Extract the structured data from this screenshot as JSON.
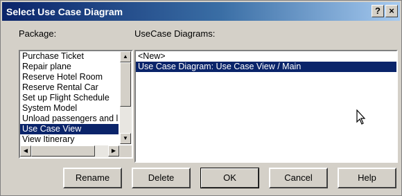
{
  "window": {
    "title": "Select Use Case Diagram",
    "help_glyph": "?",
    "close_glyph": "×"
  },
  "package": {
    "label": "Package:",
    "items": [
      {
        "label": "Purchase Ticket",
        "selected": false
      },
      {
        "label": "Repair plane",
        "selected": false
      },
      {
        "label": "Reserve Hotel Room",
        "selected": false
      },
      {
        "label": "Reserve Rental Car",
        "selected": false
      },
      {
        "label": "Set up Flight Schedule",
        "selected": false
      },
      {
        "label": "System Model",
        "selected": false
      },
      {
        "label": "Unload passengers and l",
        "selected": false
      },
      {
        "label": "Use Case View",
        "selected": true
      },
      {
        "label": "View Itinerary",
        "selected": false
      }
    ]
  },
  "diagrams": {
    "label": "UseCase Diagrams:",
    "items": [
      {
        "label": "<New>",
        "selected": false
      },
      {
        "label": "Use Case Diagram: Use Case View / Main",
        "selected": true
      }
    ]
  },
  "buttons": {
    "rename": "Rename",
    "delete": "Delete",
    "ok": "OK",
    "cancel": "Cancel",
    "help": "Help"
  },
  "icons": {
    "cursor": "mouse-pointer-icon",
    "scroll_up": "arrow-up-icon",
    "scroll_down": "arrow-down-icon",
    "scroll_left": "arrow-left-icon",
    "scroll_right": "arrow-right-icon"
  },
  "colors": {
    "selection": "#0a246a",
    "title_start": "#0a246a",
    "title_end": "#a6caf0",
    "face": "#d4d0c8"
  }
}
